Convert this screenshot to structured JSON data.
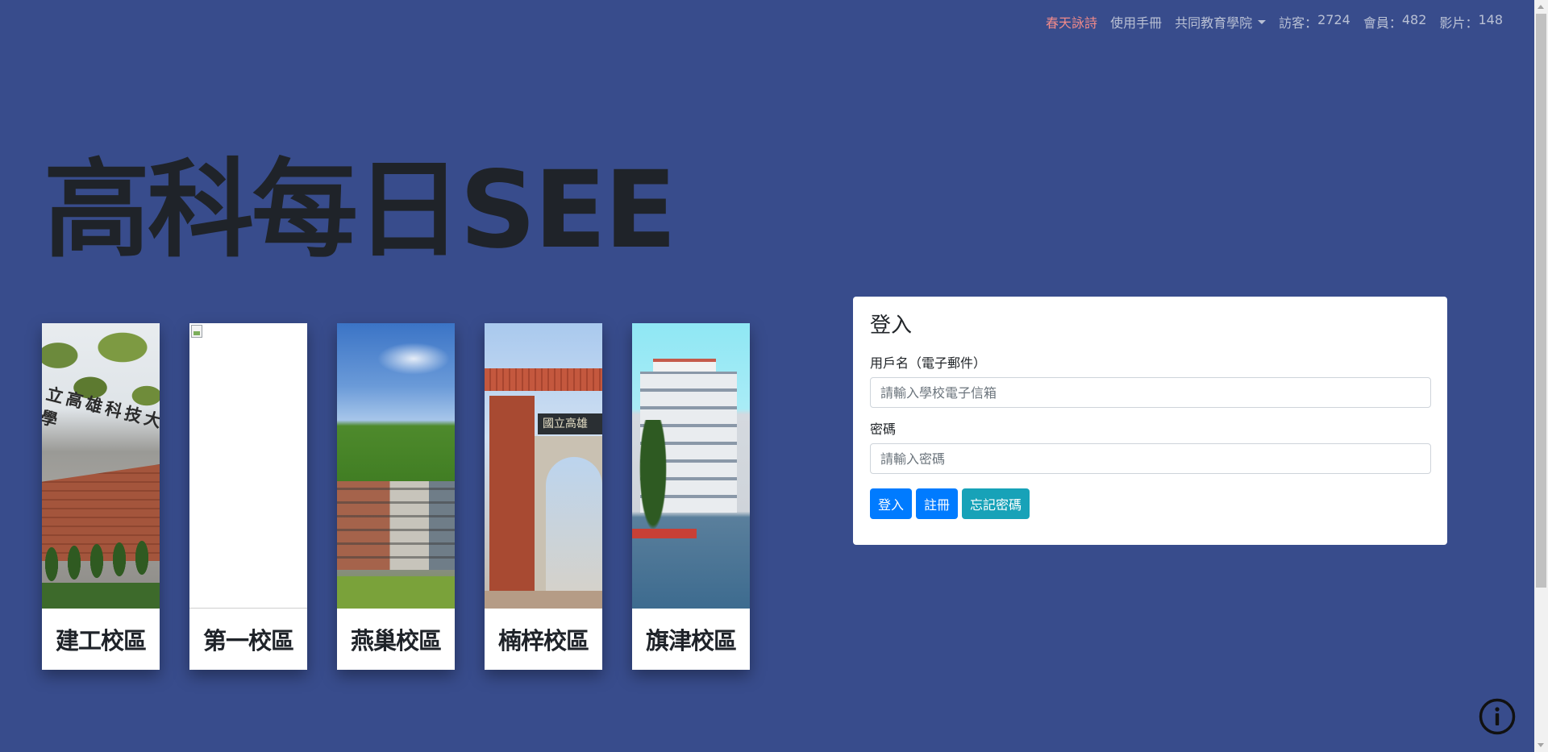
{
  "nav": {
    "items": [
      {
        "label": "春天詠詩",
        "active": true
      },
      {
        "label": "使用手冊",
        "active": false
      }
    ],
    "dropdown_label": "共同教育學院",
    "stats": [
      {
        "label": "訪客",
        "value": "2724"
      },
      {
        "label": "會員",
        "value": "482"
      },
      {
        "label": "影片",
        "value": "148"
      }
    ],
    "stat_separator": "："
  },
  "hero": {
    "title": "高科每日SEE"
  },
  "campuses": [
    {
      "name": "建工校區",
      "photo": "campus-wall-photo"
    },
    {
      "name": "第一校區",
      "photo": "broken-image"
    },
    {
      "name": "燕巢校區",
      "photo": "campus-building-photo"
    },
    {
      "name": "楠梓校區",
      "photo": "campus-gate-photo"
    },
    {
      "name": "旗津校區",
      "photo": "campus-waterfront-photo"
    }
  ],
  "photo_text": {
    "wall_inscription": "立高雄科技大學",
    "gate_plaque": "國立高雄"
  },
  "login": {
    "title": "登入",
    "username_label": "用戶名（電子郵件）",
    "username_placeholder": "請輸入學校電子信箱",
    "username_value": "",
    "password_label": "密碼",
    "password_placeholder": "請輸入密碼",
    "password_value": "",
    "buttons": {
      "login": "登入",
      "register": "註冊",
      "forgot": "忘記密碼"
    }
  },
  "icons": {
    "info": "info-icon",
    "dropdown": "caret-down-icon"
  },
  "colors": {
    "background": "#384c8c",
    "nav_text": "#b9c0d4",
    "nav_active": "#f08a8a",
    "primary_button": "#007bff",
    "info_button": "#17a2b8"
  }
}
